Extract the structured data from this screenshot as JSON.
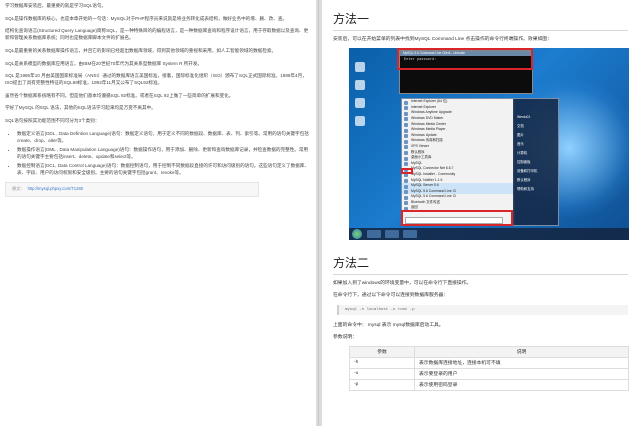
{
  "left": {
    "paragraphs": [
      "学习数据库安装后，最重要的就是学习SQL语句。",
      "SQL是操作数据库的核心，也是本章开始的一句话：MySQL对于PHP程序员来说就是将业务转化成表结构，做好业务中的增、删、改、查。",
      "结构化查询语言(Structured Query Language)简称SQL，是一种特殊目的的编程语言，是一种数据库查询和程序设计语言，用于存取数据以及查询、更新和管理关系数据库系统；同时也是数据库脚本文件的扩展名。",
      "SQL是最重要的关系数据库操作语言，并且它的影响已经超出数据库领域，得到其他领域的重视和采用，如人工智能领域的数据检索。",
      "SQL是关系模型的数据库应用语言，由IBM在20世纪70年代为其关系型数据库 System R 所开发。",
      "SQL 是1986年10 月由美国国家标准局（ANSI）通过的数据库语言美国标准，接着，国际标准化组织（ISO）颁布了SQL正式国际标准。1989年4月，ISO提出了具有完整性特征的SQL89标准，1992年11月又公布了SQL92标准。",
      "虽然各个数据库系统略有不同，但是他们基本均遵循SQL 92标准。或者在SQL 92上做了一些简单的扩展和变化。",
      "学好了MySQL 的SQL 语法，其他的SQL语法学习起来均是万变不离其中。",
      "SQL语句按照其功能范围不同可分为3个类别："
    ],
    "list": [
      "数据定义语言(DDL , Data Defintion Language)语句：数据定义语句，用于定义不同的数据段、数据库、表、列、索引等。常用的语句关键字包括create、drop、alter等。",
      "数据操作语言(DML , Data Manipulation Language)语句：数据操作语句，用于添加、删除、更新和查询数据库记录，并检查数据的完整性。常用的语句关键字主要包括insert、delete、update和select等。",
      "数据控制语言(DCL, Data Control Language)语句：数据控制语句，用于控制不同数据段直接的许可和访问级别的语句。这些语句定义了数据库、表、字段、用户的访问权限和安全级别。主要的语句关键字包括grant、revoke等。"
    ],
    "ref_label": "原文：",
    "ref_link": "http://mysql.phpxy.com/T1260"
  },
  "right": {
    "heading1": "方法一",
    "p1": "安装后，可以在开始菜单的列表中找到MySQL Command Line 点击操作的命令行终端操作。效果如图：",
    "screenshot": {
      "cmd_title": "MySQL 5.6 Command Line Client - Unicode",
      "cmd_text": "Enter password:",
      "menu_items": [
        "Internet Explorer (64 位)",
        "Internet Explorer",
        "Windows Anytime Upgrade",
        "Windows DVD Maker",
        "Windows Media Center",
        "Windows Media Player",
        "Windows Update",
        "Windows 传真和扫描",
        "XPS Viewer",
        "默认程序",
        "桌面小工具库",
        "MySQL",
        "MySQL Connector Net 6.6.7",
        "MySQL Installer - Community",
        "MySQL Notifier 1.1.6",
        "MySQL Server 5.6",
        "MySQL 5.6 Command Line Cl",
        "MySQL 5.6 Command Line Cl",
        "Bluetooth 文件传送"
      ],
      "menu_back": "返回",
      "right_items": [
        "Wenlu01",
        "文档",
        "图片",
        "音乐",
        "计算机",
        "控制面板",
        "设备和打印机",
        "默认程序",
        "帮助和支持"
      ]
    },
    "heading2": "方法二",
    "p2": "如果加入到了windows的环境变量中，可以在命令行下直接操作。",
    "p3": "在命令行下，通过以下命令可以连接到数据库服务器：",
    "code": "mysql -h localhost -u root -p",
    "p4": "上面的命令中： mysql 表示 mysql数据库启动工具。",
    "p5": "参数说明：",
    "table_headers": [
      "参数",
      "说明"
    ],
    "table_rows": [
      [
        "-h",
        "表示数据库连接地址，连接本机可不填"
      ],
      [
        "-u",
        "表示要登录的用户"
      ],
      [
        "-p",
        "表示使用密码登录"
      ]
    ]
  }
}
